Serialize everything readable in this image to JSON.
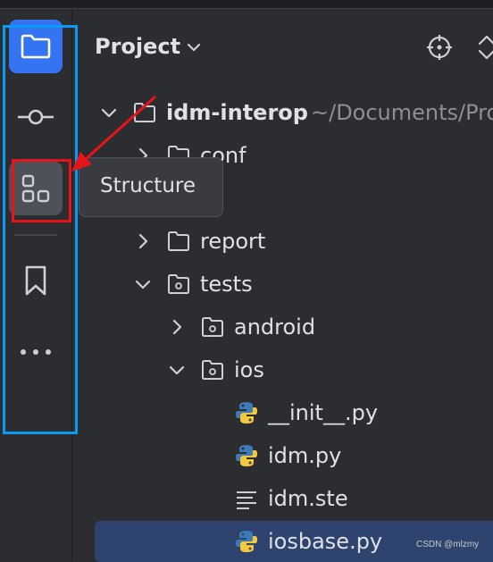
{
  "tool_strip": {
    "items": [
      {
        "name": "project",
        "icon": "folder-icon",
        "active": true
      },
      {
        "name": "commit",
        "icon": "commit-icon"
      },
      {
        "name": "structure",
        "icon": "structure-icon",
        "hovered": true
      },
      {
        "name": "bookmarks",
        "icon": "bookmark-icon"
      },
      {
        "name": "more",
        "icon": "more-horizontal-icon"
      }
    ],
    "accent_color": "#3574f0"
  },
  "tooltip": {
    "text": "Structure"
  },
  "header": {
    "title": "Project"
  },
  "tree": {
    "rows": [
      {
        "label": "idm-interop",
        "path": "~/Documents/Pro",
        "type": "root-folder",
        "expanded": true
      },
      {
        "label": "conf",
        "type": "folder",
        "expanded": false
      },
      {
        "label": "",
        "type": "folder",
        "expanded": false
      },
      {
        "label": "report",
        "type": "folder",
        "expanded": false
      },
      {
        "label": "tests",
        "type": "package",
        "expanded": true
      },
      {
        "label": "android",
        "type": "package",
        "expanded": false
      },
      {
        "label": "ios",
        "type": "package",
        "expanded": true
      },
      {
        "label": "__init__.py",
        "type": "python-file"
      },
      {
        "label": "idm.py",
        "type": "python-file"
      },
      {
        "label": "idm.ste",
        "type": "text-file"
      },
      {
        "label": "iosbase.py",
        "type": "python-file",
        "selected": true
      }
    ]
  },
  "watermark": "CSDN @mlzmy",
  "colors": {
    "background": "#2b2d30",
    "selection": "#2e436e",
    "annotation_blue": "#0a9cf5",
    "annotation_red": "#e8141c"
  }
}
